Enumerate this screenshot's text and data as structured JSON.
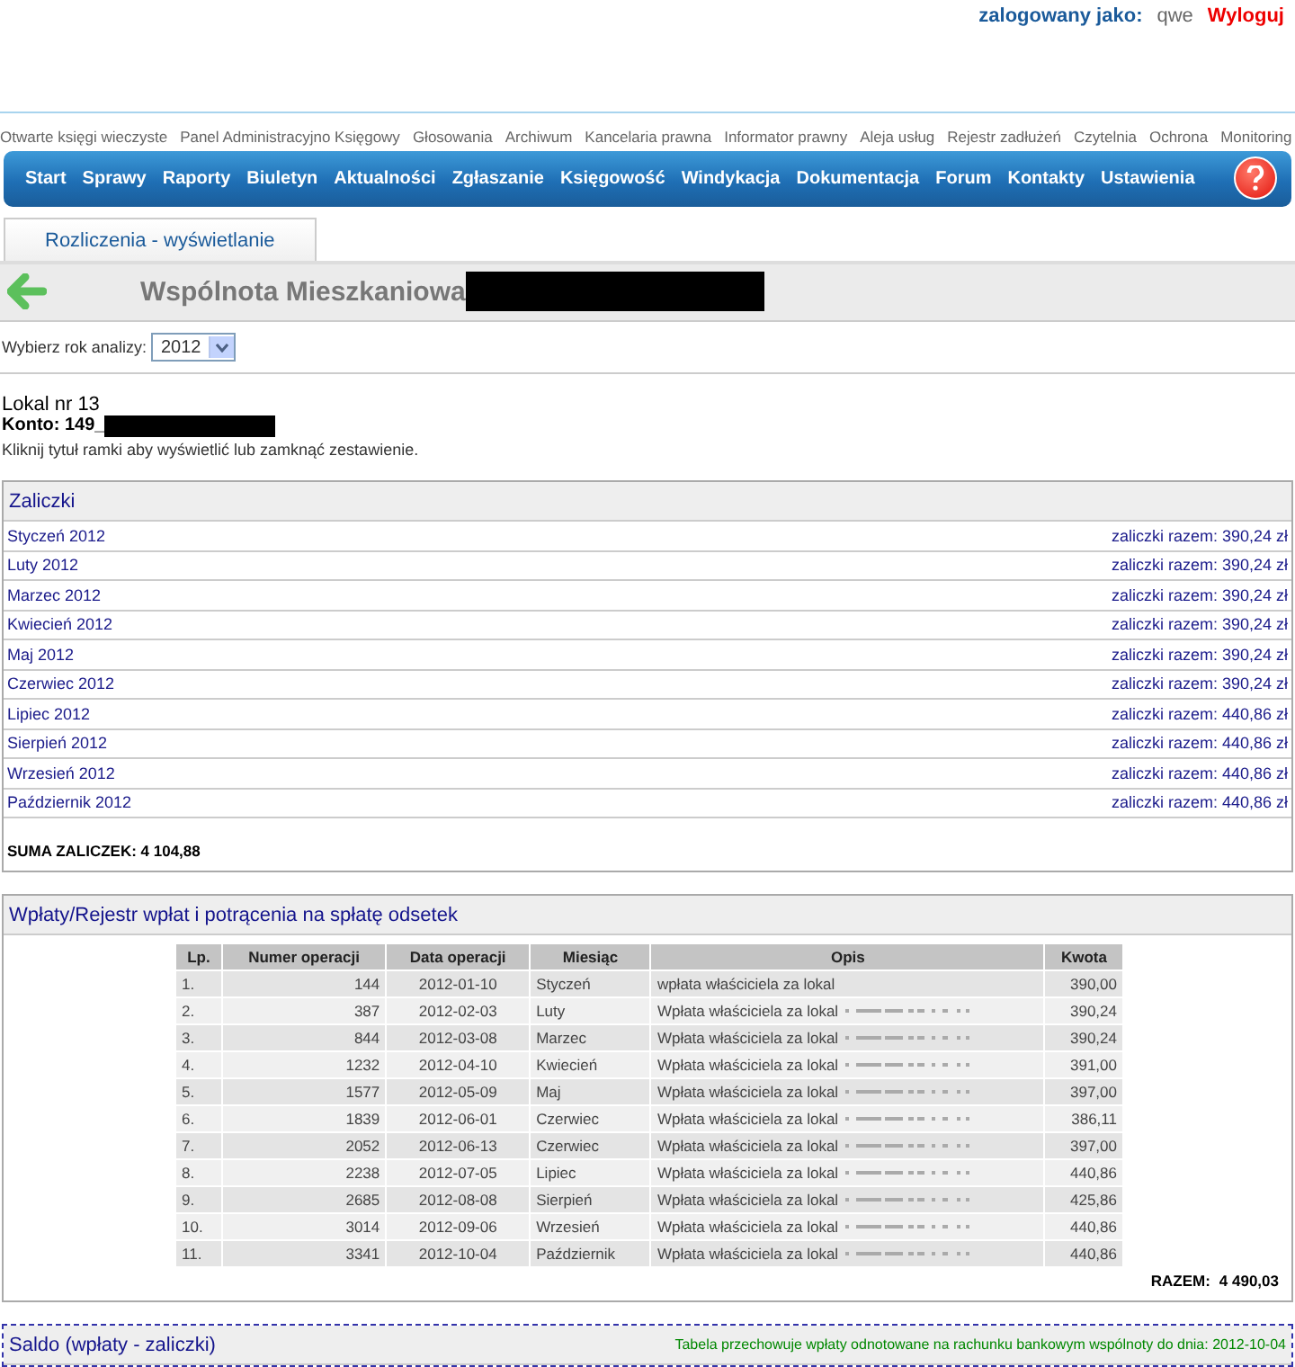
{
  "user_bar": {
    "label": "zalogowany jako:",
    "username": "qwe",
    "logout": "Wyloguj"
  },
  "top_links": [
    "Otwarte księgi wieczyste",
    "Panel Administracyjno Księgowy",
    "Głosowania",
    "Archiwum",
    "Kancelaria prawna",
    "Informator prawny",
    "Aleja usług",
    "Rejestr zadłużeń",
    "Czytelnia",
    "Ochrona",
    "Monitoring"
  ],
  "nav": [
    "Start",
    "Sprawy",
    "Raporty",
    "Biuletyn",
    "Aktualności",
    "Zgłaszanie",
    "Księgowość",
    "Windykacja",
    "Dokumentacja",
    "Forum",
    "Kontakty",
    "Ustawienia"
  ],
  "tabs": [
    {
      "label": "Rozliczenia - wyświetlanie",
      "selected": true
    }
  ],
  "header": {
    "title": "Wspólnota Mieszkaniowa",
    "redacted": true
  },
  "year_select": {
    "label": "Wybierz rok analizy:",
    "value": "2012"
  },
  "unit": {
    "lokal": "Lokal nr 13",
    "konto": "Konto: 149_",
    "konto_redacted": true,
    "hint": "Kliknij tytuł ramki aby wyświetlić lub zamknąć zestawienie."
  },
  "zaliczki": {
    "title": "Zaliczki",
    "rows": [
      {
        "month": "Styczeń 2012",
        "total": "zaliczki razem: 390,24 zł"
      },
      {
        "month": "Luty 2012",
        "total": "zaliczki razem: 390,24 zł"
      },
      {
        "month": "Marzec 2012",
        "total": "zaliczki razem: 390,24 zł"
      },
      {
        "month": "Kwiecień 2012",
        "total": "zaliczki razem: 390,24 zł"
      },
      {
        "month": "Maj 2012",
        "total": "zaliczki razem: 390,24 zł"
      },
      {
        "month": "Czerwiec 2012",
        "total": "zaliczki razem: 390,24 zł"
      },
      {
        "month": "Lipiec 2012",
        "total": "zaliczki razem: 440,86 zł"
      },
      {
        "month": "Sierpień 2012",
        "total": "zaliczki razem: 440,86 zł"
      },
      {
        "month": "Wrzesień 2012",
        "total": "zaliczki razem: 440,86 zł"
      },
      {
        "month": "Październik 2012",
        "total": "zaliczki razem: 440,86 zł"
      }
    ],
    "sum": "SUMA ZALICZEK: 4 104,88"
  },
  "wplaty": {
    "title": "Wpłaty/Rejestr wpłat i potrącenia na spłatę odsetek",
    "columns": [
      "Lp.",
      "Numer operacji",
      "Data operacji",
      "Miesiąc",
      "Opis",
      "Kwota"
    ],
    "rows": [
      {
        "lp": "1.",
        "nr": "144",
        "date": "2012-01-10",
        "month": "Styczeń",
        "desc": "wpłata właściciela za lokal",
        "obscured": false,
        "amount": "390,00"
      },
      {
        "lp": "2.",
        "nr": "387",
        "date": "2012-02-03",
        "month": "Luty",
        "desc": "Wpłata właściciela za lokal",
        "obscured": true,
        "amount": "390,24"
      },
      {
        "lp": "3.",
        "nr": "844",
        "date": "2012-03-08",
        "month": "Marzec",
        "desc": "Wpłata właściciela za lokal",
        "obscured": true,
        "amount": "390,24"
      },
      {
        "lp": "4.",
        "nr": "1232",
        "date": "2012-04-10",
        "month": "Kwiecień",
        "desc": "Wpłata właściciela za lokal",
        "obscured": true,
        "amount": "391,00"
      },
      {
        "lp": "5.",
        "nr": "1577",
        "date": "2012-05-09",
        "month": "Maj",
        "desc": "Wpłata właściciela za lokal",
        "obscured": true,
        "amount": "397,00"
      },
      {
        "lp": "6.",
        "nr": "1839",
        "date": "2012-06-01",
        "month": "Czerwiec",
        "desc": "Wpłata właściciela za lokal",
        "obscured": true,
        "amount": "386,11"
      },
      {
        "lp": "7.",
        "nr": "2052",
        "date": "2012-06-13",
        "month": "Czerwiec",
        "desc": "Wpłata właściciela za lokal",
        "obscured": true,
        "amount": "397,00"
      },
      {
        "lp": "8.",
        "nr": "2238",
        "date": "2012-07-05",
        "month": "Lipiec",
        "desc": "Wpłata właściciela za lokal",
        "obscured": true,
        "amount": "440,86"
      },
      {
        "lp": "9.",
        "nr": "2685",
        "date": "2012-08-08",
        "month": "Sierpień",
        "desc": "Wpłata właściciela za lokal",
        "obscured": true,
        "amount": "425,86"
      },
      {
        "lp": "10.",
        "nr": "3014",
        "date": "2012-09-06",
        "month": "Wrzesień",
        "desc": "Wpłata właściciela za lokal",
        "obscured": true,
        "amount": "440,86"
      },
      {
        "lp": "11.",
        "nr": "3341",
        "date": "2012-10-04",
        "month": "Październik",
        "desc": "Wpłata właściciela za lokal",
        "obscured": true,
        "amount": "440,86"
      }
    ],
    "total_label": "RAZEM:",
    "total": "4 490,03"
  },
  "saldo": {
    "title": "Saldo (wpłaty - zaliczki)",
    "note": "Tabela przechowuje wpłaty odnotowane na rachunku bankowym wspólnoty do dnia: 2012-10-04"
  }
}
